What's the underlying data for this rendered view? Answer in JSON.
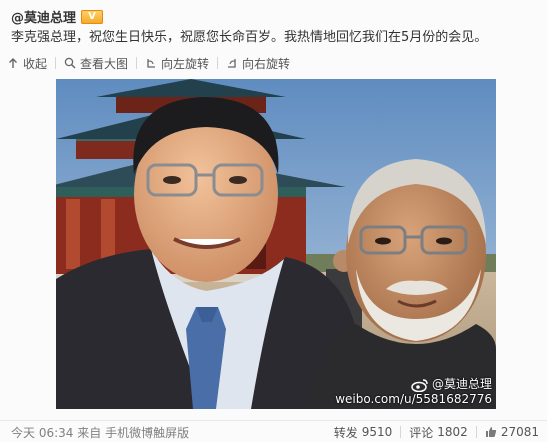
{
  "post": {
    "author": "@莫迪总理",
    "badge_label": "V",
    "text": "李克强总理，祝您生日快乐，祝愿您长命百岁。我热情地回忆我们在5月份的会见。"
  },
  "toolbar": {
    "collapse": "收起",
    "view_large": "查看大图",
    "rotate_left": "向左旋转",
    "rotate_right": "向右旋转"
  },
  "watermark": {
    "name": "@莫迪总理",
    "url": "weibo.com/u/5581682776"
  },
  "footer": {
    "time": "今天 06:34",
    "source_prefix": "来自",
    "source": "手机微博触屏版",
    "repost_label": "转发",
    "repost_count": "9510",
    "comment_label": "评论",
    "comment_count": "1802",
    "like_count": "27081"
  },
  "colors": {
    "badge": "#f6a623",
    "text": "#333333",
    "muted": "#808080"
  },
  "icons": [
    "collapse-icon",
    "magnifier-icon",
    "rotate-left-icon",
    "rotate-right-icon",
    "weibo-logo-icon",
    "thumbs-up-icon"
  ]
}
